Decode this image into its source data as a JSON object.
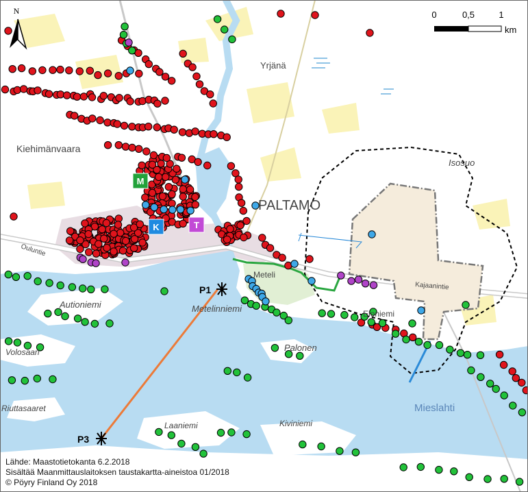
{
  "north_arrow": {
    "letter": "N"
  },
  "scale_bar": {
    "ticks": [
      "0",
      "0,5",
      "1"
    ],
    "unit": "km"
  },
  "place_labels": {
    "yrjana": "Yrjänä",
    "isosuo": "Isosuo",
    "kiehimanvaara": "Kiehimänvaara",
    "paltamo": "PALTAMO",
    "oulunt": "Ouluntie",
    "kajaanintie": "Kajaanintie",
    "meteli": "Meteli",
    "metelinniemi": "Metelinniemi",
    "autioniemi": "Autioniemi",
    "eloniemi": "Eloniemi",
    "palonen": "Palonen",
    "volosaari": "Volosaari",
    "riuttasaaret": "Riuttasaaret",
    "laaniemi": "Laaniemi",
    "kiviniemi": "Kiviniemi",
    "mieslahti": "Mieslahti"
  },
  "points": {
    "p1": "P1",
    "p3": "P3"
  },
  "badges": {
    "m": "M",
    "k": "K",
    "t": "T"
  },
  "credits": {
    "line1": "Lähde: Maastotietokanta 6.2.2018",
    "line2": "Sisältää Maanmittauslaitoksen taustakartta-aineistoa 01/2018",
    "line3": "© Pöyry Finland Oy 2018"
  },
  "colors": {
    "water": "#b8dcf2",
    "land": "#ffffff",
    "urban": "#e8dde3",
    "field": "#faf3b8",
    "project_area": "#f5ecdc",
    "red_dot": "#e0141c",
    "green_dot": "#22c23a",
    "blue_dot": "#3fa8e8",
    "purple_dot": "#b044c8",
    "route_orange": "#ec7a38",
    "route_green": "#2aa640",
    "route_blue": "#2a8ad8"
  }
}
